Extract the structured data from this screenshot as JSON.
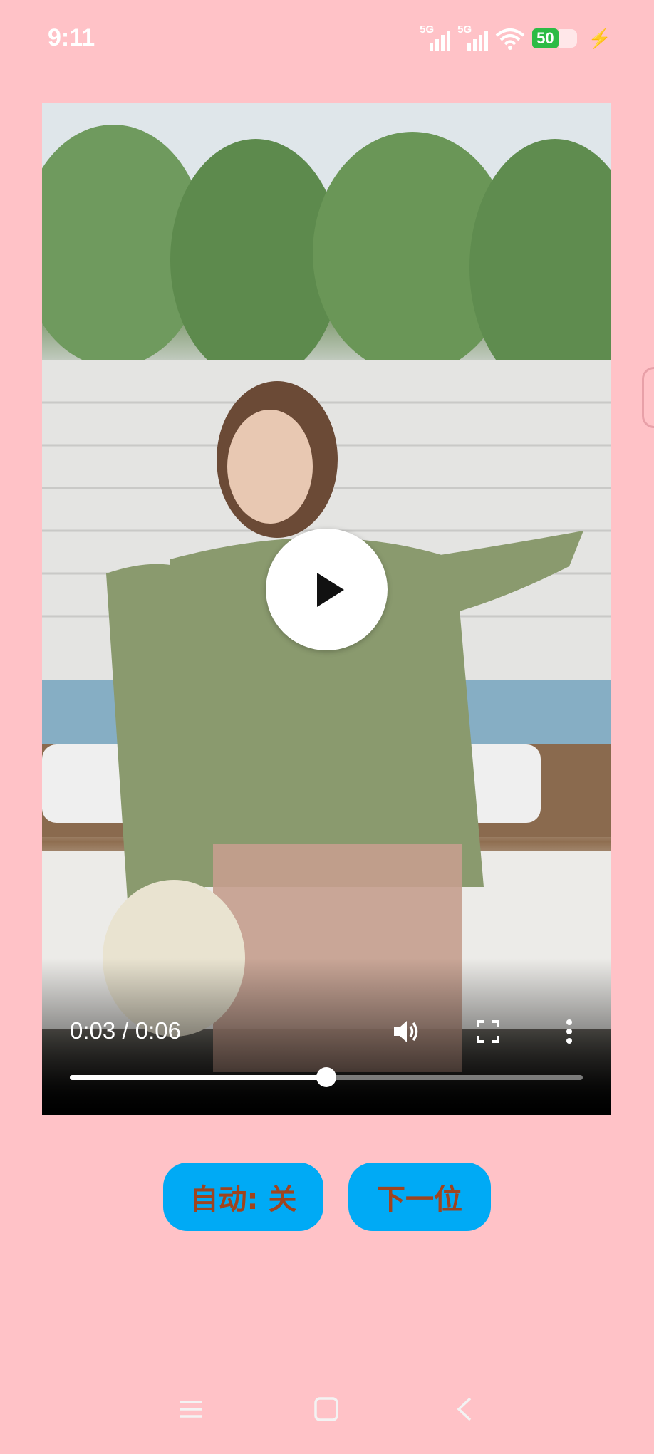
{
  "status_bar": {
    "time": "9:11",
    "network_1": "5G",
    "network_2": "5G",
    "battery": "50",
    "icons": [
      "signal-icon",
      "wifi-icon",
      "battery-icon",
      "charging-icon"
    ]
  },
  "video": {
    "current_time": "0:03",
    "separator": "/",
    "duration": "0:06",
    "progress_fraction": 0.5,
    "icons": [
      "play-icon",
      "volume-icon",
      "fullscreen-icon",
      "more-icon"
    ]
  },
  "buttons": {
    "auto_label": "自动: 关",
    "next_label": "下一位"
  },
  "colors": {
    "background": "#ffc2c7",
    "button_bg": "#00aaf5",
    "button_text": "#a0441e"
  },
  "navbar": {
    "icons": [
      "menu-icon",
      "home-icon",
      "back-icon"
    ]
  }
}
